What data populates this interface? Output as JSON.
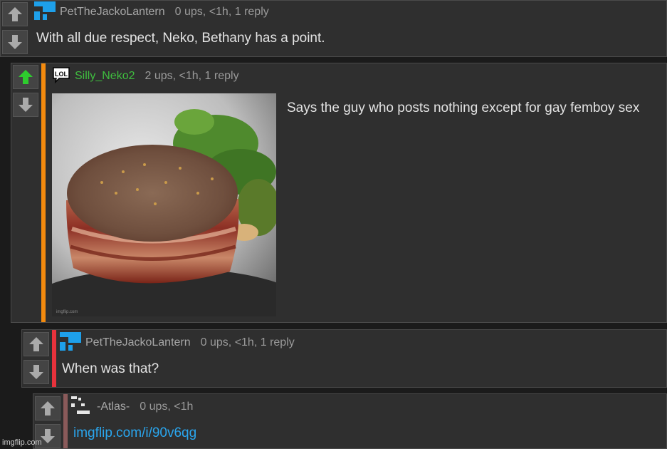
{
  "comments": [
    {
      "username": "PetTheJackoLantern",
      "meta": "0 ups, <1h, 1 reply",
      "text": "With all due respect, Neko, Bethany has a point.",
      "avatar_icon": "blue-pixel-avatar-icon"
    },
    {
      "username": "Silly_Neko2",
      "meta": "2 ups, <1h, 1 reply",
      "text": "Says the guy who posts nothing except for gay femboy sex",
      "avatar_icon": "lol-speech-bubble-icon",
      "avatar_text": "LOL",
      "image_alt": "bacon-wrapped filet mignon steak on a dark plate with salad greens",
      "image_watermark": "imgflip.com",
      "upvoted": true,
      "bar_color": "#f38a0e"
    },
    {
      "username": "PetTheJackoLantern",
      "meta": "0 ups, <1h, 1 reply",
      "text": "When was that?",
      "avatar_icon": "blue-pixel-avatar-icon",
      "bar_color": "#e8323c"
    },
    {
      "username": "-Atlas-",
      "meta": "0 ups, <1h",
      "link": "imgflip.com/i/90v6qg",
      "avatar_icon": "pixel-pattern-avatar-icon",
      "bar_color": "#8a5a5a"
    }
  ],
  "watermark": "imgflip.com",
  "colors": {
    "upvote_active": "#2ecc2e",
    "arrow": "#aaaaaa",
    "link": "#2aa6ee"
  }
}
